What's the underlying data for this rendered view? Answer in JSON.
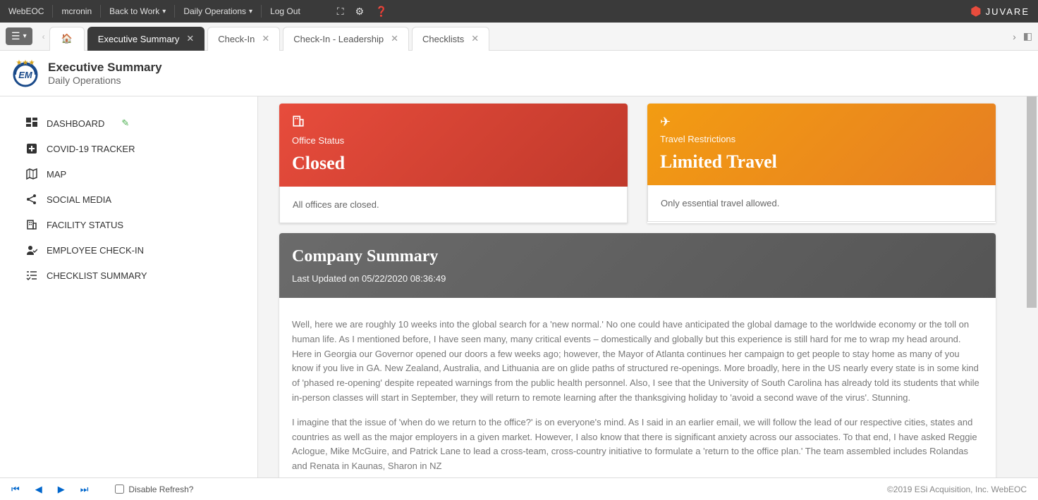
{
  "topbar": {
    "items": [
      "WebEOC",
      "mcronin",
      "Back to Work",
      "Daily Operations",
      "Log Out"
    ],
    "dropdowns": [
      false,
      false,
      true,
      true,
      false
    ],
    "brand": "JUVARE"
  },
  "tabs": {
    "items": [
      {
        "label": "",
        "home": true,
        "active": false,
        "closable": false
      },
      {
        "label": "Executive Summary",
        "home": false,
        "active": true,
        "closable": true
      },
      {
        "label": "Check-In",
        "home": false,
        "active": false,
        "closable": true
      },
      {
        "label": "Check-In - Leadership",
        "home": false,
        "active": false,
        "closable": true
      },
      {
        "label": "Checklists",
        "home": false,
        "active": false,
        "closable": true
      }
    ]
  },
  "header": {
    "title": "Executive Summary",
    "subtitle": "Daily Operations"
  },
  "sidebar": {
    "items": [
      {
        "label": "DASHBOARD",
        "icon": "dashboard",
        "active": true,
        "edit": true
      },
      {
        "label": "COVID-19 TRACKER",
        "icon": "plus",
        "active": false,
        "edit": false
      },
      {
        "label": "MAP",
        "icon": "map",
        "active": false,
        "edit": false
      },
      {
        "label": "SOCIAL MEDIA",
        "icon": "share",
        "active": false,
        "edit": false
      },
      {
        "label": "FACILITY STATUS",
        "icon": "building",
        "active": false,
        "edit": false
      },
      {
        "label": "EMPLOYEE CHECK-IN",
        "icon": "person",
        "active": false,
        "edit": false
      },
      {
        "label": "CHECKLIST SUMMARY",
        "icon": "checklist",
        "active": false,
        "edit": false
      }
    ]
  },
  "cards": {
    "office": {
      "label": "Office Status",
      "value": "Closed",
      "detail": "All offices are closed."
    },
    "travel": {
      "label": "Travel Restrictions",
      "value": "Limited Travel",
      "detail": "Only essential travel allowed."
    }
  },
  "summary": {
    "title": "Company Summary",
    "updated": "Last Updated on 05/22/2020 08:36:49",
    "p1": "Well, here we are roughly 10 weeks into the global search for a 'new normal.' No one could have anticipated the global damage to the worldwide economy or the toll on human life. As I mentioned before, I have seen many, many critical events – domestically and globally but this experience is still hard for me to wrap my head around.",
    "p2": "Here in Georgia our Governor opened our doors a few weeks ago; however, the Mayor of Atlanta continues her campaign to get people to stay home as many of you know if you live in GA. New Zealand, Australia, and Lithuania are on glide paths of structured re-openings. More broadly, here in the US nearly every state is in some kind of 'phased re-opening' despite repeated warnings from the public health personnel. Also, I see that the University of South Carolina has already told its students that while in-person classes will start in September, they will return to remote learning after the thanksgiving holiday to 'avoid a second wave of the virus'. Stunning.",
    "p3": "I imagine that the issue of 'when do we return to the office?' is on everyone's mind. As I said in an earlier email, we will follow the lead of our respective cities, states and countries as well as the major employers in a given market. However, I also know that there is significant anxiety across our associates. To that end, I have asked Reggie Aclogue, Mike McGuire, and Patrick Lane to lead a cross-team, cross-country initiative to formulate a 'return to the office plan.' The team assembled includes Rolandas and Renata in Kaunas, Sharon in NZ"
  },
  "footer": {
    "refresh": "Disable Refresh?",
    "copyright": "©2019 ESi Acquisition, Inc. WebEOC"
  }
}
